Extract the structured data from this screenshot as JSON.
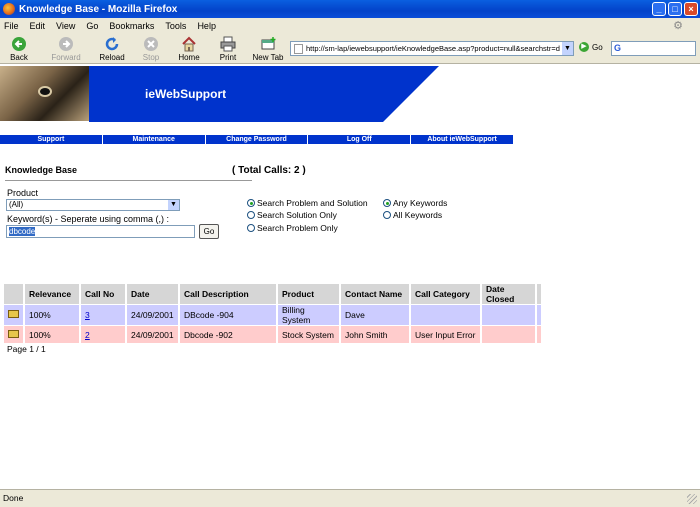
{
  "window": {
    "title": "Knowledge Base - Mozilla Firefox"
  },
  "menu": [
    "File",
    "Edit",
    "View",
    "Go",
    "Bookmarks",
    "Tools",
    "Help"
  ],
  "toolbar": {
    "back": "Back",
    "forward": "Forward",
    "reload": "Reload",
    "stop": "Stop",
    "home": "Home",
    "print": "Print",
    "new_tab": "New Tab",
    "url": "http://sm-lap/iewebsupport/ieKnowledgeBase.asp?product=null&searchstr=d",
    "go": "Go",
    "search_logo": "G"
  },
  "banner": {
    "title": "ieWebSupport"
  },
  "nav": [
    "Support",
    "Maintenance",
    "Change Password",
    "Log Off",
    "About ieWebSupport"
  ],
  "page": {
    "title": "Knowledge Base",
    "total_calls": "( Total Calls: 2 )",
    "product_label": "Product",
    "product_value": "(All)",
    "keyword_label": "Keyword(s) - Seperate using comma (,) :",
    "keyword_value": "dbcode",
    "go_button": "Go",
    "search_options": [
      {
        "label": "Search Problem and Solution",
        "checked": true
      },
      {
        "label": "Search Solution Only",
        "checked": false
      },
      {
        "label": "Search Problem Only",
        "checked": false
      }
    ],
    "keyword_options": [
      {
        "label": "Any Keywords",
        "checked": true
      },
      {
        "label": "All Keywords",
        "checked": false
      }
    ],
    "pager": "Page 1 / 1"
  },
  "table": {
    "headers": [
      "",
      "Relevance",
      "Call No",
      "Date",
      "Call Description",
      "Product",
      "Contact Name",
      "Call Category",
      "Date Closed",
      ""
    ],
    "rows": [
      {
        "relevance": "100%",
        "call_no": "3",
        "date": "24/09/2001",
        "description": "DBcode -904",
        "product": "Billing System",
        "contact": "Dave",
        "category": "",
        "closed": ""
      },
      {
        "relevance": "100%",
        "call_no": "2",
        "date": "24/09/2001",
        "description": "Dbcode -902",
        "product": "Stock System",
        "contact": "John Smith",
        "category": "User Input Error",
        "closed": ""
      }
    ]
  },
  "status": {
    "text": "Done"
  },
  "colors": {
    "nav": "#0033cc",
    "row1": "#ccccff",
    "row2": "#ffcccc",
    "banner": "#0033cc"
  }
}
